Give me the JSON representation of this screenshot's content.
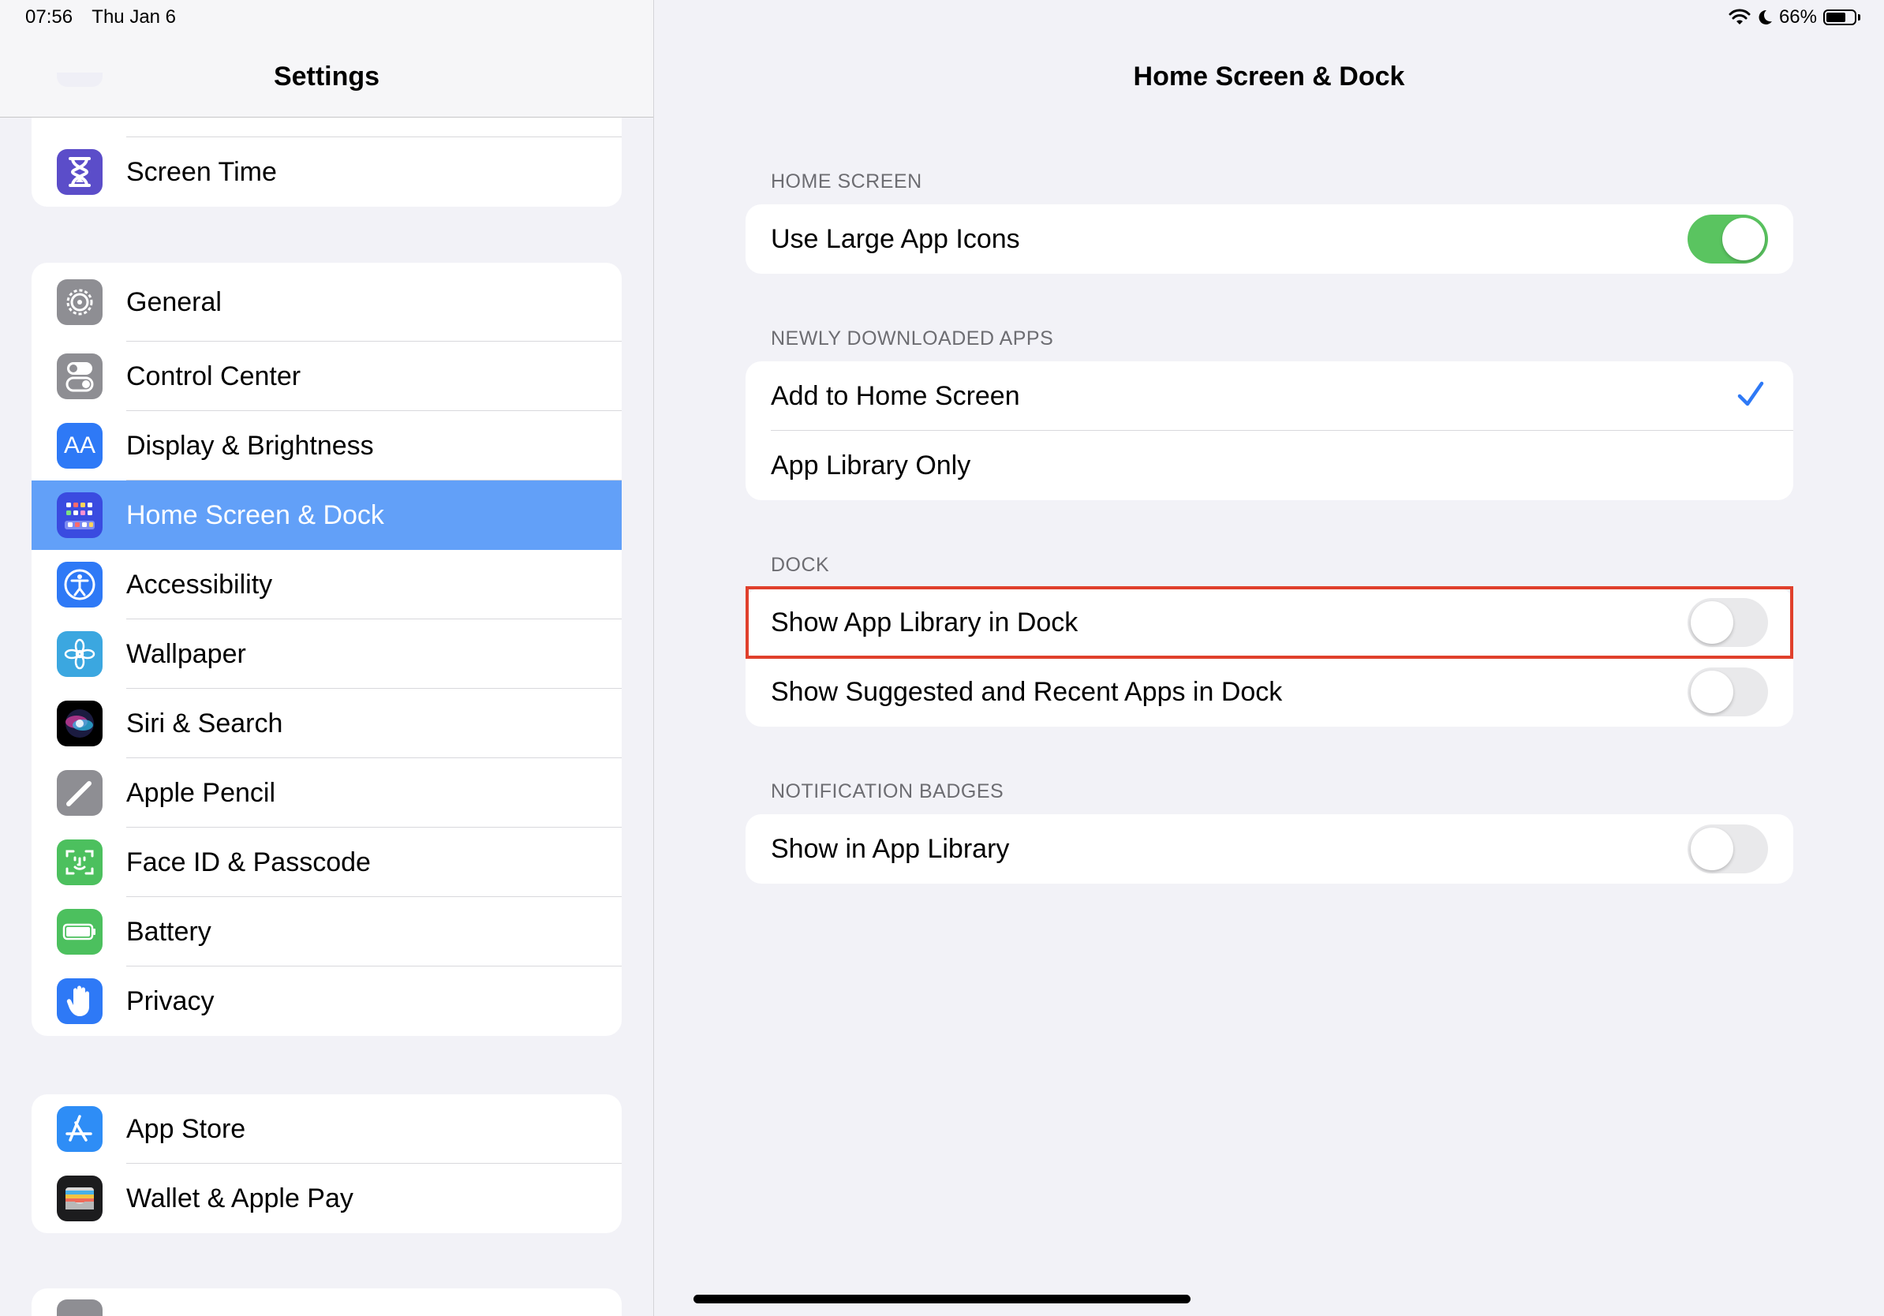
{
  "status_bar": {
    "time": "07:56",
    "date": "Thu Jan 6",
    "battery": "66%",
    "battery_level": 0.66,
    "icons": [
      "wifi-icon",
      "do-not-disturb-moon-icon",
      "battery-icon"
    ]
  },
  "sidebar": {
    "title": "Settings",
    "group1": [
      {
        "label": "Screen Time",
        "icon": "hourglass-icon",
        "color": "#5b4dc9"
      }
    ],
    "group2": [
      {
        "label": "General",
        "icon": "gear-icon",
        "color": "#8e8e93"
      },
      {
        "label": "Control Center",
        "icon": "switches-icon",
        "color": "#8e8e93"
      },
      {
        "label": "Display & Brightness",
        "icon": "text-size-icon",
        "icon_text": "AA",
        "color": "#2e79f6"
      },
      {
        "label": "Home Screen & Dock",
        "icon": "app-grid-icon",
        "color": "#3a4be0",
        "selected": true
      },
      {
        "label": "Accessibility",
        "icon": "accessibility-person-icon",
        "color": "#2e79f6"
      },
      {
        "label": "Wallpaper",
        "icon": "flower-icon",
        "color": "#3ba7e0"
      },
      {
        "label": "Siri & Search",
        "icon": "siri-orb-icon",
        "color": "#000000"
      },
      {
        "label": "Apple Pencil",
        "icon": "pencil-icon",
        "color": "#8e8e93"
      },
      {
        "label": "Face ID & Passcode",
        "icon": "face-id-icon",
        "color": "#4cc05e"
      },
      {
        "label": "Battery",
        "icon": "battery-icon",
        "color": "#4cc05e"
      },
      {
        "label": "Privacy",
        "icon": "hand-icon",
        "color": "#2e79f6"
      }
    ],
    "group3": [
      {
        "label": "App Store",
        "icon": "app-store-icon",
        "color": "#2e8df6"
      },
      {
        "label": "Wallet & Apple Pay",
        "icon": "wallet-icon",
        "color": "#1c1c1e"
      }
    ]
  },
  "detail": {
    "title": "Home Screen & Dock",
    "sections": {
      "home_screen": {
        "header": "HOME SCREEN",
        "rows": [
          {
            "label": "Use Large App Icons",
            "toggle": true
          }
        ]
      },
      "newly_downloaded": {
        "header": "NEWLY DOWNLOADED APPS",
        "rows": [
          {
            "label": "Add to Home Screen",
            "checked": true
          },
          {
            "label": "App Library Only",
            "checked": false
          }
        ]
      },
      "dock": {
        "header": "DOCK",
        "rows": [
          {
            "label": "Show App Library in Dock",
            "toggle": false,
            "highlighted": true
          },
          {
            "label": "Show Suggested and Recent Apps in Dock",
            "toggle": false
          }
        ]
      },
      "badges": {
        "header": "NOTIFICATION BADGES",
        "rows": [
          {
            "label": "Show in App Library",
            "toggle": false
          }
        ]
      }
    },
    "colors": {
      "toggle_on": "#5ac460",
      "accent": "#2e79f6",
      "highlight_border": "#e0402c"
    }
  }
}
